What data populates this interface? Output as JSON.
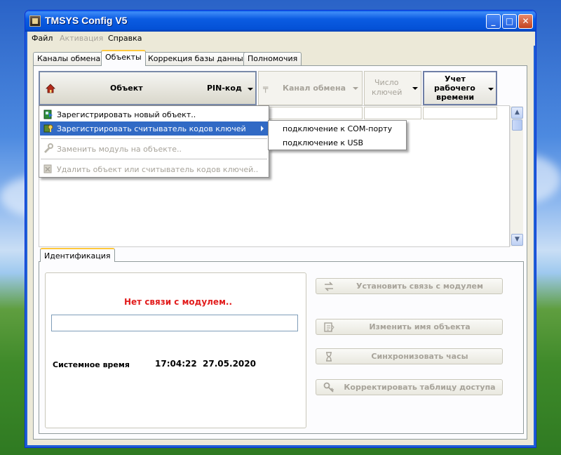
{
  "window": {
    "title": "TMSYS Config V5"
  },
  "menu": [
    {
      "label": "Файл",
      "enabled": true
    },
    {
      "label": "Активация",
      "enabled": false
    },
    {
      "label": "Справка",
      "enabled": true
    }
  ],
  "tabs": [
    {
      "label": "Каналы обмена",
      "active": false
    },
    {
      "label": "Объекты",
      "active": true
    },
    {
      "label": "Коррекция базы данных",
      "active": false
    },
    {
      "label": "Полномочия",
      "active": false
    }
  ],
  "columns": {
    "object": "Объект",
    "pin": "PIN-код",
    "channel": "Канал обмена",
    "keys_line1": "Число",
    "keys_line2": "ключей",
    "time_line1": "Учет",
    "time_line2": "рабочего",
    "time_line3": "времени"
  },
  "context_menu": [
    {
      "label": "Зарегистрировать новый объект..",
      "enabled": true,
      "highlighted": false,
      "icon": "register-object-icon"
    },
    {
      "label": "Зарегистрировать считыватель кодов ключей",
      "enabled": true,
      "highlighted": true,
      "icon": "key-reader-icon",
      "has_submenu": true
    },
    {
      "label": "Заменить модуль на объекте..",
      "enabled": false,
      "highlighted": false,
      "icon": "replace-module-icon"
    },
    {
      "label": "Удалить объект или считыватель кодов ключей..",
      "enabled": false,
      "highlighted": false,
      "icon": "delete-icon"
    }
  ],
  "submenu": [
    {
      "label": "подключение к COM-порту"
    },
    {
      "label": "подключение к USB"
    }
  ],
  "identification": {
    "tab_label": "Идентификация",
    "status_message": "Нет связи с модулем..",
    "status_color": "#e21d1d",
    "system_time_label": "Системное время",
    "system_time_value": "17:04:22  27.05.2020"
  },
  "actions": [
    {
      "label": "Установить связь с модулем",
      "icon": "connect-icon",
      "enabled": false
    },
    {
      "label": "Изменить имя объекта",
      "icon": "rename-icon",
      "enabled": false
    },
    {
      "label": "Синхронизовать часы",
      "icon": "hourglass-icon",
      "enabled": false
    },
    {
      "label": "Корректировать таблицу доступа",
      "icon": "key-icon",
      "enabled": false
    }
  ],
  "colors": {
    "title_bar": "#0451d6",
    "highlight": "#316ac5",
    "tab_accent": "#ffc83c",
    "disabled_text": "#a7a39a"
  }
}
